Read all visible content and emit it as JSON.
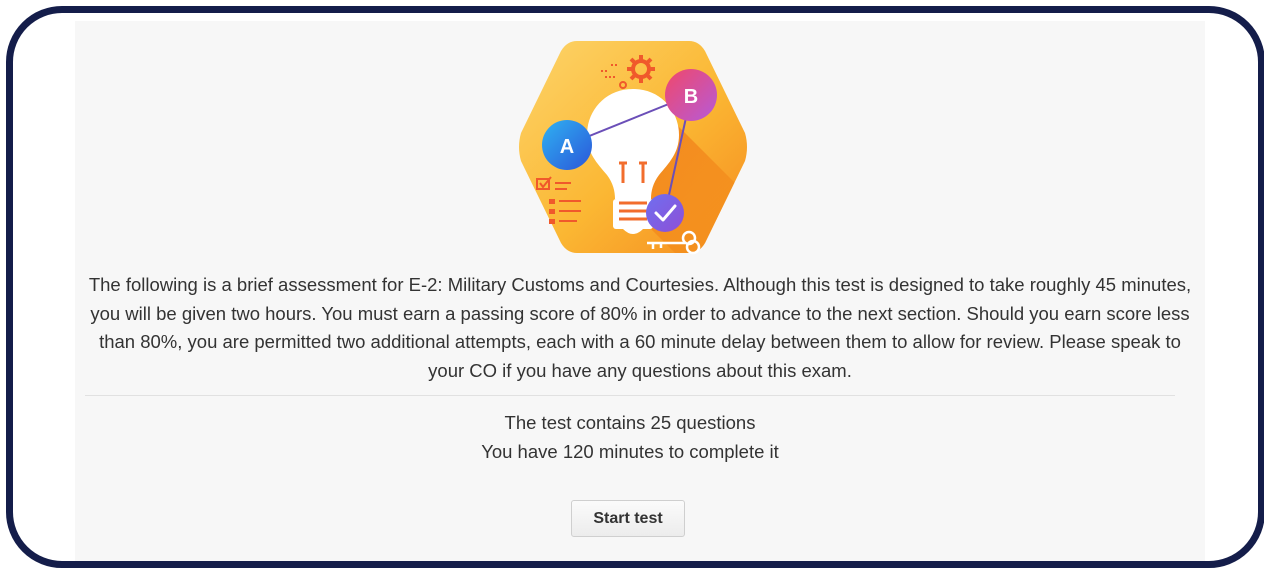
{
  "description": "The following is a brief assessment for E-2: Military Customs and Courtesies. Although this test is designed to take roughly 45 minutes, you will be given two hours. You must earn a passing score of 80% in order to advance to the next section. Should you earn score less than 80%, you are permitted two additional attempts, each with a 60 minute delay between them to allow for review. Please speak to your CO if you have any questions about this exam.",
  "info": {
    "questions_line": "The test contains 25 questions",
    "time_line": "You have 120 minutes to complete it"
  },
  "illustration": {
    "node_a_label": "A",
    "node_b_label": "B",
    "icons": [
      "lightbulb-icon",
      "gear-icon",
      "checklist-icon",
      "checkmark-icon",
      "key-icon"
    ]
  },
  "start_button": {
    "label": "Start test"
  },
  "colors": {
    "frame_border": "#141d4a",
    "panel_bg": "#f7f7f7",
    "hexagon_orange": "#f7a21b",
    "node_a_blue": "#1e88e5",
    "node_b_pink": "#e8457a",
    "check_purple": "#7b4ee8"
  }
}
